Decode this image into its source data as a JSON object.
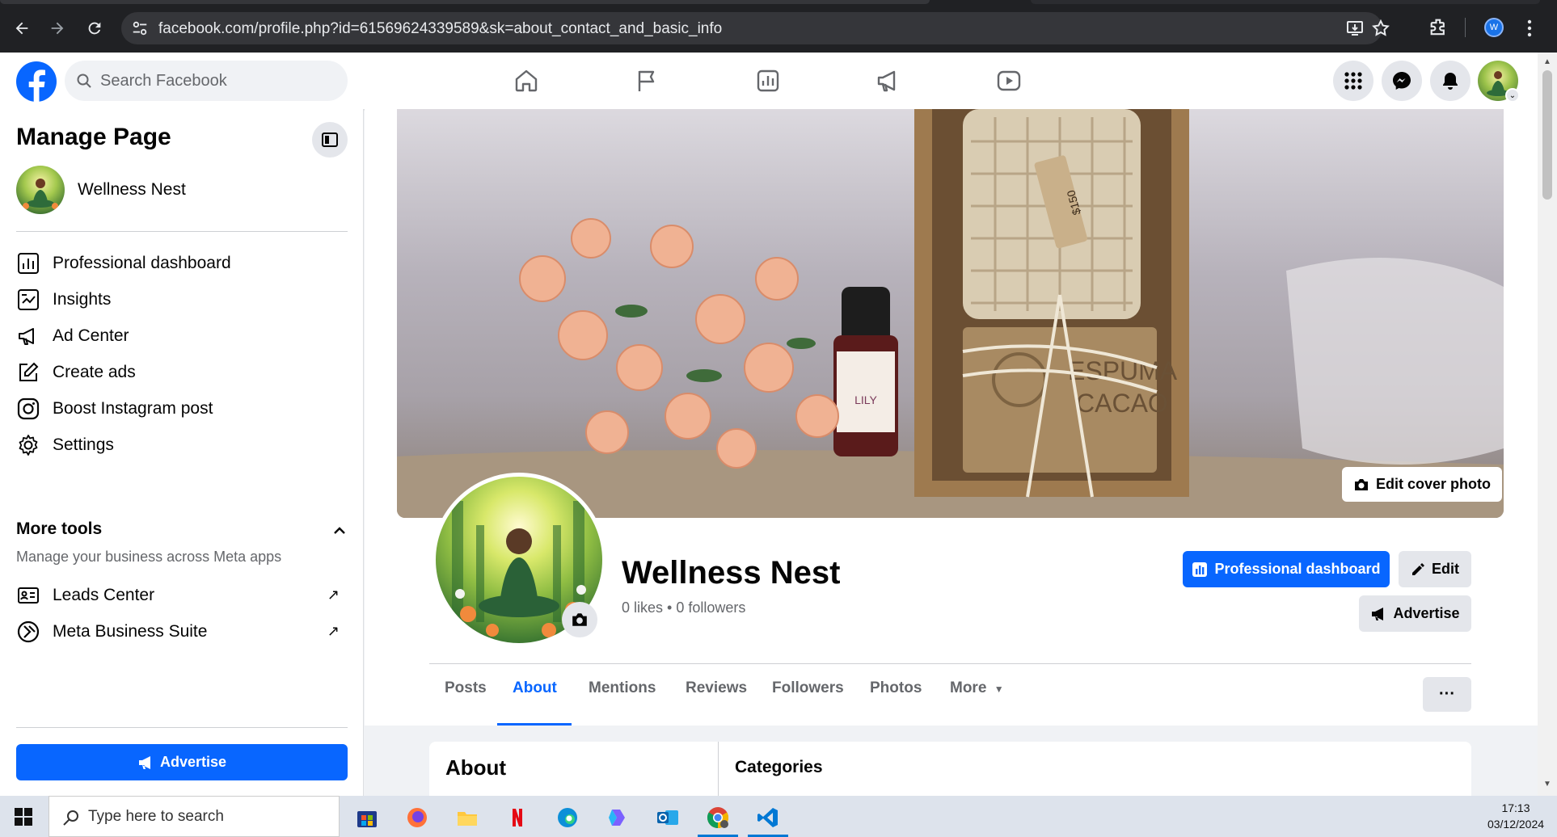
{
  "browser": {
    "url": "facebook.com/profile.php?id=61569624339589&sk=about_contact_and_basic_info",
    "profile_initial": "W"
  },
  "header": {
    "search_placeholder": "Search Facebook"
  },
  "sidebar": {
    "title": "Manage Page",
    "page_name": "Wellness Nest",
    "items": [
      {
        "label": "Professional dashboard",
        "icon": "dashboard-icon"
      },
      {
        "label": "Insights",
        "icon": "insights-icon"
      },
      {
        "label": "Ad Center",
        "icon": "megaphone-icon"
      },
      {
        "label": "Create ads",
        "icon": "edit-icon"
      },
      {
        "label": "Boost Instagram post",
        "icon": "instagram-icon"
      },
      {
        "label": "Settings",
        "icon": "gear-icon"
      }
    ],
    "more_tools": {
      "title": "More tools",
      "subtitle": "Manage your business across Meta apps",
      "items": [
        {
          "label": "Leads Center",
          "icon": "leads-icon"
        },
        {
          "label": "Meta Business Suite",
          "icon": "meta-business-icon"
        }
      ]
    },
    "advertise_label": "Advertise"
  },
  "profile": {
    "edit_cover_label": "Edit cover photo",
    "name": "Wellness Nest",
    "stats": "0 likes • 0 followers",
    "pro_dashboard_label": "Professional dashboard",
    "edit_label": "Edit",
    "advertise_label": "Advertise",
    "tabs": [
      "Posts",
      "About",
      "Mentions",
      "Reviews",
      "Followers",
      "Photos",
      "More"
    ],
    "active_tab": "About",
    "more_options": "···"
  },
  "about": {
    "title": "About",
    "categories_title": "Categories"
  },
  "cover_photo": {
    "tag_text": "$150",
    "box_text_line1": "ESPUMA",
    "box_text_line2": "CACAO",
    "bottle_label": "LILY"
  },
  "taskbar": {
    "search_placeholder": "Type here to search",
    "time": "17:13",
    "date": "03/12/2024"
  },
  "colors": {
    "fb_blue": "#0866ff",
    "gray_button": "#e4e6eb"
  }
}
